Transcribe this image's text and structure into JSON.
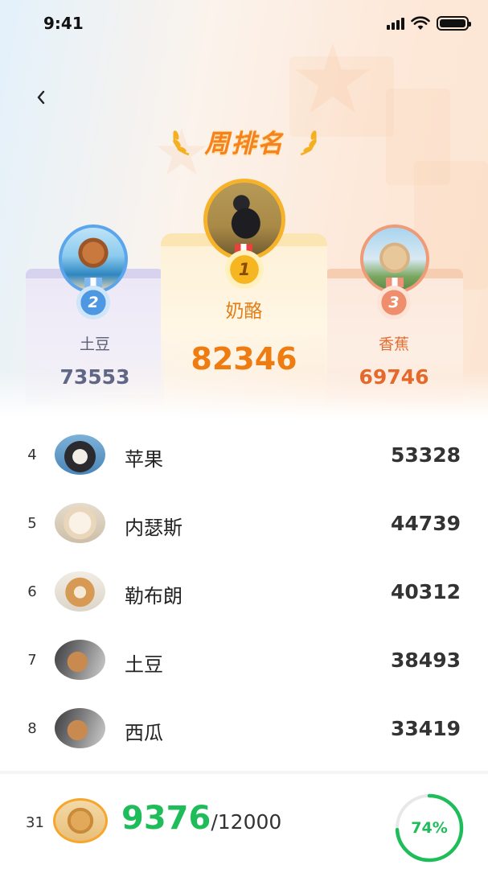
{
  "status_bar": {
    "time": "9:41"
  },
  "header": {
    "title": "周排名"
  },
  "podium": [
    {
      "rank": "2",
      "name": "土豆",
      "score": "73553"
    },
    {
      "rank": "1",
      "name": "奶酪",
      "score": "82346"
    },
    {
      "rank": "3",
      "name": "香蕉",
      "score": "69746"
    }
  ],
  "ranking": [
    {
      "rank": "4",
      "name": "苹果",
      "score": "53328"
    },
    {
      "rank": "5",
      "name": "内瑟斯",
      "score": "44739"
    },
    {
      "rank": "6",
      "name": "勒布朗",
      "score": "40312"
    },
    {
      "rank": "7",
      "name": "土豆",
      "score": "38493"
    },
    {
      "rank": "8",
      "name": "西瓜",
      "score": "33419"
    }
  ],
  "my_status": {
    "rank": "31",
    "score": "9376",
    "goal": "/12000",
    "progress_label": "74%",
    "progress_fraction": 0.74
  },
  "colors": {
    "accent_orange": "#ef7c10",
    "progress_green": "#1fbd5a",
    "silver_blue": "#5aa5ec",
    "gold": "#f6b32a",
    "bronze": "#ef9b78"
  },
  "icons": {
    "back": "chevron-left-icon",
    "signal": "cellular-signal-icon",
    "wifi": "wifi-icon",
    "battery": "battery-icon",
    "laurel": "laurel-icon"
  }
}
